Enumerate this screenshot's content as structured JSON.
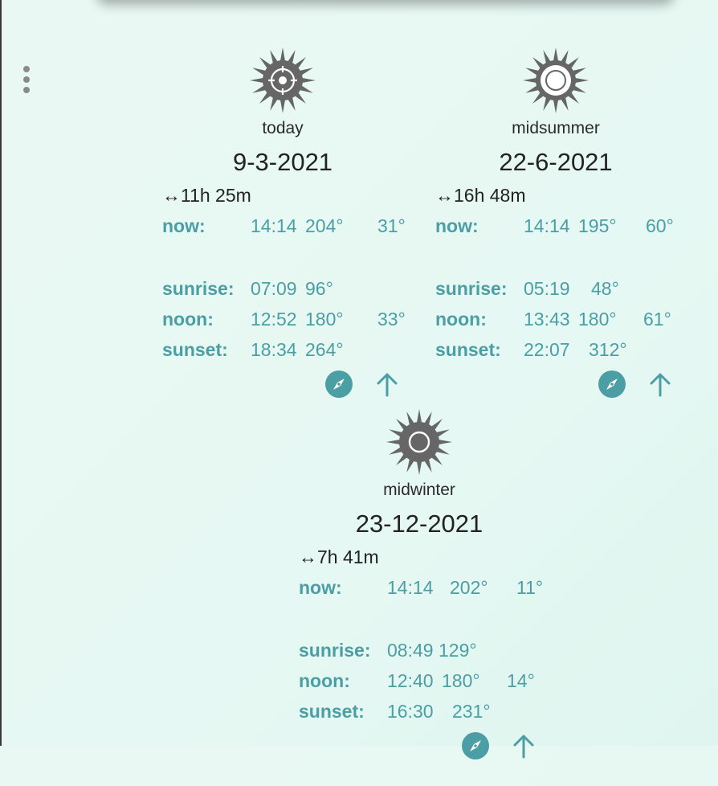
{
  "menu": {
    "icon": "more-vertical-icon"
  },
  "colors": {
    "accent": "#4a9ea4",
    "sun": "#666666",
    "background": "#e8f8f3"
  },
  "cards": [
    {
      "label": "today",
      "date": "9-3-2021",
      "day_length": "↔11h 25m",
      "sun_icon": "sun-crosshair-icon",
      "rows": [
        {
          "label": "now:",
          "time": "14:14",
          "azimuth": "204°",
          "elevation": "31°"
        },
        {
          "label": "sunrise:",
          "time": "07:09",
          "azimuth": "96°",
          "elevation": ""
        },
        {
          "label": "noon:",
          "time": "12:52",
          "azimuth": "180°",
          "elevation": "33°"
        },
        {
          "label": "sunset:",
          "time": "18:34",
          "azimuth": "264°",
          "elevation": ""
        }
      ]
    },
    {
      "label": "midsummer",
      "date": "22-6-2021",
      "day_length": "↔16h 48m",
      "sun_icon": "sun-ring-icon",
      "rows": [
        {
          "label": "now:",
          "time": "14:14",
          "azimuth": "195°",
          "elevation": "60°"
        },
        {
          "label": "sunrise:",
          "time": "05:19",
          "azimuth": "48°",
          "elevation": ""
        },
        {
          "label": "noon:",
          "time": "13:43",
          "azimuth": "180°",
          "elevation": "61°"
        },
        {
          "label": "sunset:",
          "time": "22:07",
          "azimuth": "312°",
          "elevation": ""
        }
      ]
    },
    {
      "label": "midwinter",
      "date": "23-12-2021",
      "day_length": "↔7h 41m",
      "sun_icon": "sun-ring-icon",
      "rows": [
        {
          "label": "now:",
          "time": "14:14",
          "azimuth": "202°",
          "elevation": "11°"
        },
        {
          "label": "sunrise:",
          "time": "08:49",
          "azimuth": "129°",
          "elevation": ""
        },
        {
          "label": "noon:",
          "time": "12:40",
          "azimuth": "180°",
          "elevation": "14°"
        },
        {
          "label": "sunset:",
          "time": "16:30",
          "azimuth": "231°",
          "elevation": ""
        }
      ]
    }
  ]
}
